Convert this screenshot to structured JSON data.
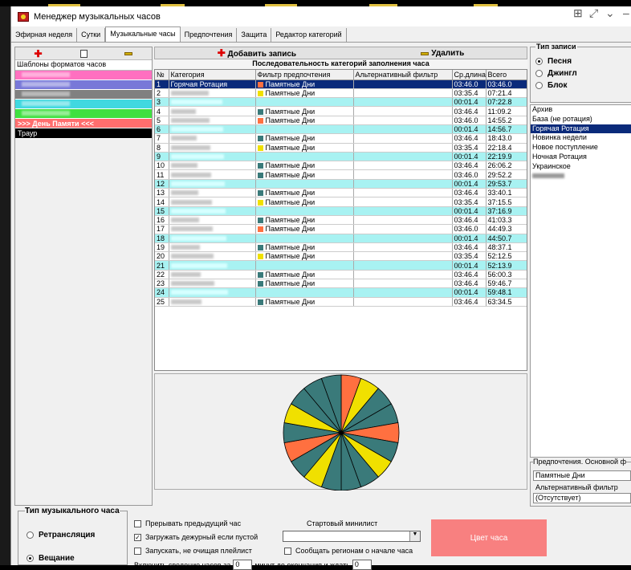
{
  "window": {
    "title": "Менеджер музыкальных часов"
  },
  "tabs": [
    "Эфирная неделя",
    "Сутки",
    "Музыкальные часы",
    "Предпочтения",
    "Защита",
    "Редактор категорий"
  ],
  "left_panel": {
    "header": "Шаблоны форматов часов",
    "templates": [
      {
        "color": "#ff70c0",
        "label": ""
      },
      {
        "color": "#7878d8",
        "label": ""
      },
      {
        "color": "#808080",
        "label": ""
      },
      {
        "color": "#40d8e0",
        "label": ""
      },
      {
        "color": "#40e040",
        "label": ""
      },
      {
        "color": "#ff6e6e",
        "label": ">>> День Памяти <<<"
      },
      {
        "color": "#000000",
        "label": "Траур"
      }
    ]
  },
  "center": {
    "add_label": "Добавить запись",
    "delete_label": "Удалить",
    "title": "Последовательность категорий заполнения часа",
    "columns": [
      "№",
      "Категория",
      "Фильтр предпочтения",
      "Альтернативный фильтр",
      "Ср.длина",
      "Всего"
    ],
    "rows": [
      {
        "n": "1",
        "cat": "Горячая Ротация",
        "swatch": "#ff7040",
        "filter": "Памятные Дни",
        "avg": "03:46.0",
        "total": "03:46.0",
        "style": "sel"
      },
      {
        "n": "2",
        "cat": "",
        "swatch": "#f0e000",
        "filter": "Памятные Дни",
        "avg": "03:35.4",
        "total": "07:21.4",
        "style": ""
      },
      {
        "n": "3",
        "cat": "",
        "swatch": "",
        "filter": "",
        "avg": "00:01.4",
        "total": "07:22.8",
        "style": "cyan"
      },
      {
        "n": "4",
        "cat": "",
        "swatch": "#3a7a7a",
        "filter": "Памятные Дни",
        "avg": "03:46.4",
        "total": "11:09.2",
        "style": ""
      },
      {
        "n": "5",
        "cat": "",
        "swatch": "#ff7040",
        "filter": "Памятные Дни",
        "avg": "03:46.0",
        "total": "14:55.2",
        "style": ""
      },
      {
        "n": "6",
        "cat": "",
        "swatch": "",
        "filter": "",
        "avg": "00:01.4",
        "total": "14:56.7",
        "style": "cyan"
      },
      {
        "n": "7",
        "cat": "",
        "swatch": "#3a7a7a",
        "filter": "Памятные Дни",
        "avg": "03:46.4",
        "total": "18:43.0",
        "style": ""
      },
      {
        "n": "8",
        "cat": "",
        "swatch": "#f0e000",
        "filter": "Памятные Дни",
        "avg": "03:35.4",
        "total": "22:18.4",
        "style": ""
      },
      {
        "n": "9",
        "cat": "",
        "swatch": "",
        "filter": "",
        "avg": "00:01.4",
        "total": "22:19.9",
        "style": "cyan"
      },
      {
        "n": "10",
        "cat": "",
        "swatch": "#3a7a7a",
        "filter": "Памятные Дни",
        "avg": "03:46.4",
        "total": "26:06.2",
        "style": ""
      },
      {
        "n": "11",
        "cat": "",
        "swatch": "#3a7a7a",
        "filter": "Памятные Дни",
        "avg": "03:46.0",
        "total": "29:52.2",
        "style": ""
      },
      {
        "n": "12",
        "cat": "",
        "swatch": "",
        "filter": "",
        "avg": "00:01.4",
        "total": "29:53.7",
        "style": "cyan"
      },
      {
        "n": "13",
        "cat": "",
        "swatch": "#3a7a7a",
        "filter": "Памятные Дни",
        "avg": "03:46.4",
        "total": "33:40.1",
        "style": ""
      },
      {
        "n": "14",
        "cat": "",
        "swatch": "#f0e000",
        "filter": "Памятные Дни",
        "avg": "03:35.4",
        "total": "37:15.5",
        "style": ""
      },
      {
        "n": "15",
        "cat": "",
        "swatch": "",
        "filter": "",
        "avg": "00:01.4",
        "total": "37:16.9",
        "style": "cyan"
      },
      {
        "n": "16",
        "cat": "",
        "swatch": "#3a7a7a",
        "filter": "Памятные Дни",
        "avg": "03:46.4",
        "total": "41:03.3",
        "style": ""
      },
      {
        "n": "17",
        "cat": "",
        "swatch": "#ff7040",
        "filter": "Памятные Дни",
        "avg": "03:46.0",
        "total": "44:49.3",
        "style": ""
      },
      {
        "n": "18",
        "cat": "",
        "swatch": "",
        "filter": "",
        "avg": "00:01.4",
        "total": "44:50.7",
        "style": "cyan"
      },
      {
        "n": "19",
        "cat": "",
        "swatch": "#3a7a7a",
        "filter": "Памятные Дни",
        "avg": "03:46.4",
        "total": "48:37.1",
        "style": ""
      },
      {
        "n": "20",
        "cat": "",
        "swatch": "#f0e000",
        "filter": "Памятные Дни",
        "avg": "03:35.4",
        "total": "52:12.5",
        "style": ""
      },
      {
        "n": "21",
        "cat": "",
        "swatch": "",
        "filter": "",
        "avg": "00:01.4",
        "total": "52:13.9",
        "style": "cyan"
      },
      {
        "n": "22",
        "cat": "",
        "swatch": "#3a7a7a",
        "filter": "Памятные Дни",
        "avg": "03:46.4",
        "total": "56:00.3",
        "style": ""
      },
      {
        "n": "23",
        "cat": "",
        "swatch": "#3a7a7a",
        "filter": "Памятные Дни",
        "avg": "03:46.4",
        "total": "59:46.7",
        "style": ""
      },
      {
        "n": "24",
        "cat": "",
        "swatch": "",
        "filter": "",
        "avg": "00:01.4",
        "total": "59:48.1",
        "style": "cyan"
      },
      {
        "n": "25",
        "cat": "",
        "swatch": "#3a7a7a",
        "filter": "Памятные Дни",
        "avg": "03:46.4",
        "total": "63:34.5",
        "style": ""
      }
    ],
    "pie_colors": [
      "#ff7040",
      "#f0e000",
      "#3a7a7a",
      "#3a7a7a",
      "#ff7040",
      "#3a7a7a",
      "#f0e000",
      "#3a7a7a",
      "#3a7a7a",
      "#3a7a7a",
      "#f0e000",
      "#3a7a7a",
      "#ff7040",
      "#3a7a7a",
      "#f0e000",
      "#3a7a7a",
      "#3a7a7a",
      "#3a7a7a"
    ]
  },
  "right_panel": {
    "type_legend": "Тип записи",
    "types": [
      "Песня",
      "Джингл",
      "Блок"
    ],
    "selected_type": 0,
    "categories": [
      "Архив",
      "База (не ротация)",
      "Горячая Ротация",
      "Новинка недели",
      "Новое поступление",
      "Ночная Ротация",
      "Украинское",
      ""
    ],
    "selected_category": 2,
    "pref_legend": "Предпочтения. Основной ф",
    "pref_value": "Памятные Дни",
    "alt_label": "Альтернативный фильтр",
    "alt_value": "(Отсутствует)"
  },
  "bottom": {
    "type_legend": "Тип музыкального часа",
    "mode_retrans": "Ретрансляция",
    "mode_broadcast": "Вещание",
    "cb_interrupt": "Прерывать предыдущий час",
    "cb_load_duty": "Загружать дежурный если пустой",
    "cb_no_clear": "Запускать, не очищая плейлист",
    "start_minilist_label": "Стартовый минилист",
    "cb_notify_regions": "Сообщать регионам о начале часа",
    "color_button": "Цвет часа",
    "enable_prefix": "Включить сведение часов за",
    "enable_val1": "0",
    "enable_mid": "минут до окончания и ждать",
    "enable_val2": "0"
  },
  "colors": {
    "selection": "#0a2a7a",
    "cyan_row": "#a8f2f2",
    "orange": "#ff7040",
    "yellow": "#f0e000",
    "teal": "#3a7a7a"
  }
}
